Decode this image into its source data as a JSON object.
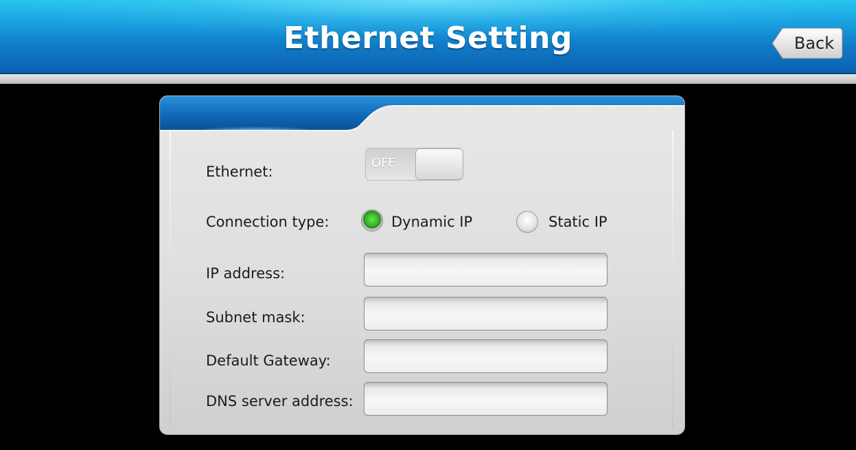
{
  "header": {
    "title": "Ethernet Setting",
    "back_label": "Back"
  },
  "settings": {
    "ethernet_label": "Ethernet:",
    "ethernet_toggle_state": "OFF",
    "connection_type_label": "Connection type:",
    "connection_options": [
      {
        "label": "Dynamic IP",
        "selected": true
      },
      {
        "label": "Static IP",
        "selected": false
      }
    ],
    "fields": [
      {
        "label": "IP address:",
        "value": ""
      },
      {
        "label": "Subnet mask:",
        "value": ""
      },
      {
        "label": "Default Gateway:",
        "value": ""
      },
      {
        "label": "DNS server address:",
        "value": ""
      }
    ]
  },
  "colors": {
    "header_blue": "#117cc9",
    "radio_selected_green": "#2eb41d",
    "background": "#000000"
  },
  "icons": {
    "back": "back-arrow-button-icon",
    "radio_on": "radio-selected-icon",
    "radio_off": "radio-unselected-icon"
  }
}
